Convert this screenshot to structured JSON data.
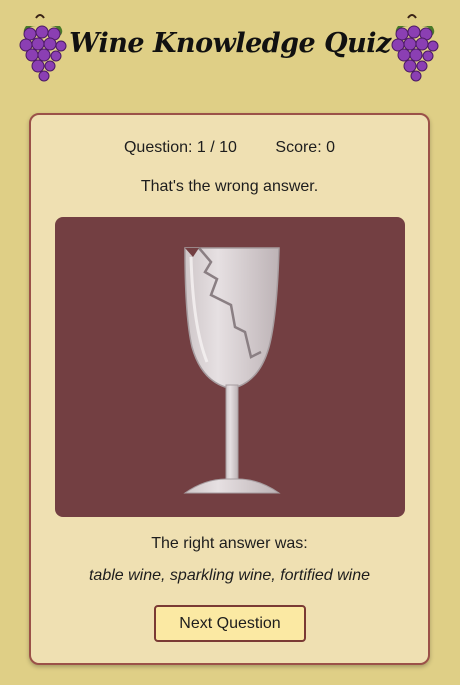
{
  "header": {
    "title": "Wine Knowledge Quiz",
    "left_icon": "grapes-icon",
    "right_icon": "grapes-icon"
  },
  "quiz": {
    "question_label": "Question: 1 / 10",
    "score_label": "Score: 0",
    "feedback": "That's the wrong answer.",
    "image_icon": "broken-wine-glass-icon",
    "right_answer_label": "The right answer was:",
    "right_answer": "table wine, sparkling wine, fortified wine",
    "next_button": "Next Question"
  },
  "colors": {
    "page_background": "#dfcf86",
    "card_background": "#efe0b2",
    "card_border": "#9b5148",
    "image_background": "#733f42",
    "button_background": "#fbe9a3",
    "grape_purple": "#8b3fb3",
    "leaf_green": "#4a7a2a"
  }
}
